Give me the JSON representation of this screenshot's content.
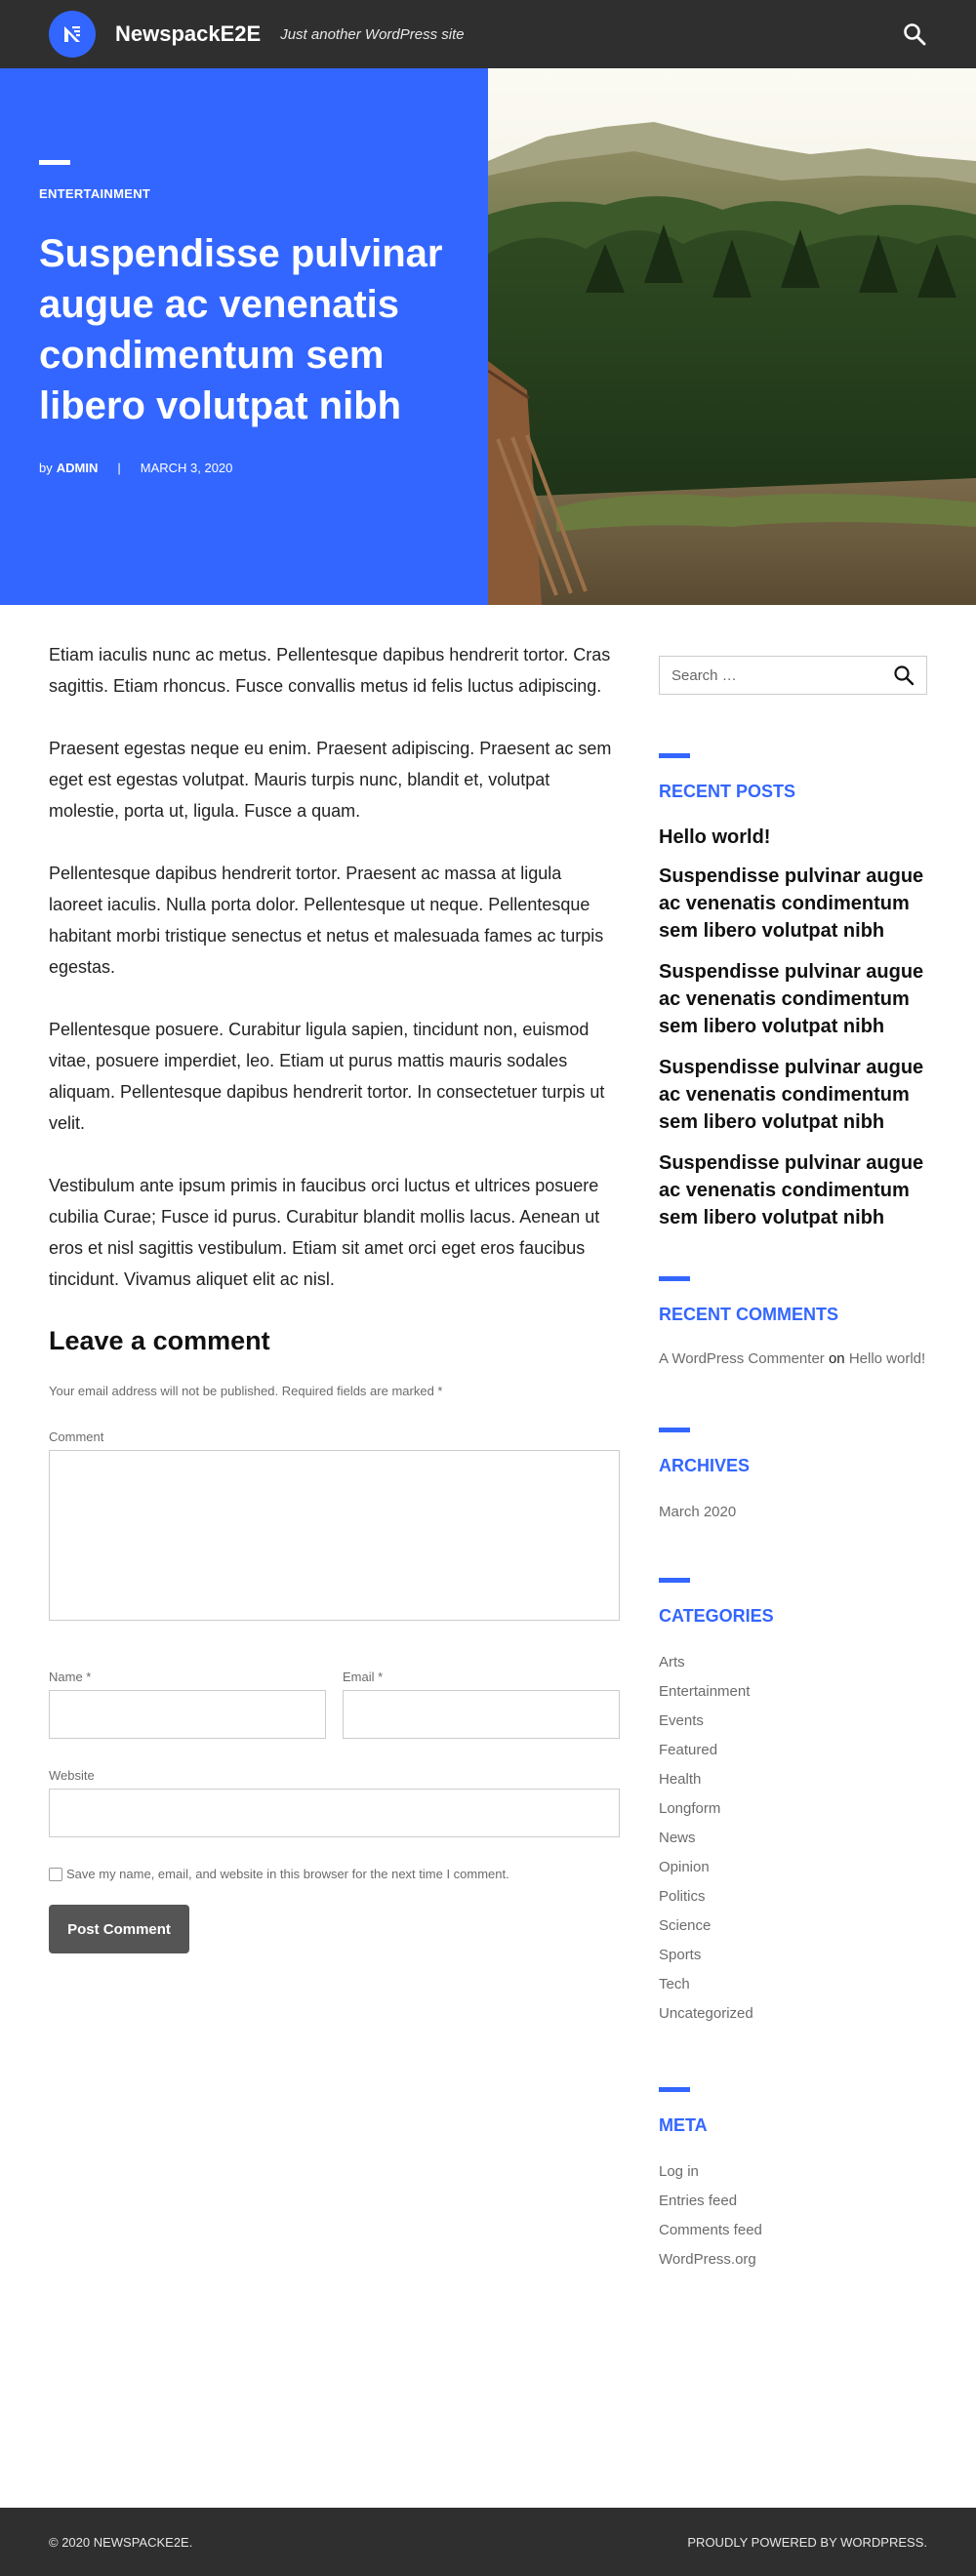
{
  "header": {
    "site_title": "NewspackE2E",
    "tagline": "Just another WordPress site"
  },
  "hero": {
    "category": "ENTERTAINMENT",
    "title": "Suspendisse pulvinar augue ac venenatis condimentum sem libero volutpat nibh",
    "by_label": "by",
    "author": "ADMIN",
    "separator": "|",
    "date": "MARCH 3, 2020"
  },
  "article": {
    "paragraphs": [
      "Etiam iaculis nunc ac metus. Pellentesque dapibus hendrerit tortor. Cras sagittis. Etiam rhoncus. Fusce convallis metus id felis luctus adipiscing.",
      "Praesent egestas neque eu enim. Praesent adipiscing. Praesent ac sem eget est egestas volutpat. Mauris turpis nunc, blandit et, volutpat molestie, porta ut, ligula. Fusce a quam.",
      "Pellentesque dapibus hendrerit tortor. Praesent ac massa at ligula laoreet iaculis. Nulla porta dolor. Pellentesque ut neque. Pellentesque habitant morbi tristique senectus et netus et malesuada fames ac turpis egestas.",
      "Pellentesque posuere. Curabitur ligula sapien, tincidunt non, euismod vitae, posuere imperdiet, leo. Etiam ut purus mattis mauris sodales aliquam. Pellentesque dapibus hendrerit tortor. In consectetuer turpis ut velit.",
      "Vestibulum ante ipsum primis in faucibus orci luctus et ultrices posuere cubilia Curae; Fusce id purus. Curabitur blandit mollis lacus. Aenean ut eros et nisl sagittis vestibulum. Etiam sit amet orci eget eros faucibus tincidunt. Vivamus aliquet elit ac nisl."
    ]
  },
  "comment_form": {
    "heading": "Leave a comment",
    "notes": "Your email address will not be published. Required fields are marked *",
    "comment_label": "Comment",
    "name_label": "Name *",
    "email_label": "Email *",
    "website_label": "Website",
    "cookie_label": "Save my name, email, and website in this browser for the next time I comment.",
    "submit_label": "Post Comment"
  },
  "sidebar": {
    "search_placeholder": "Search …",
    "recent_posts_title": "RECENT POSTS",
    "recent_posts": [
      "Hello world!",
      "Suspendisse pulvinar augue ac venenatis condimentum sem libero volutpat nibh",
      "Suspendisse pulvinar augue ac venenatis condimentum sem libero volutpat nibh",
      "Suspendisse pulvinar augue ac venenatis condimentum sem libero volutpat nibh",
      "Suspendisse pulvinar augue ac venenatis condimentum sem libero volutpat nibh"
    ],
    "recent_comments_title": "RECENT COMMENTS",
    "recent_comment": {
      "author": "A WordPress Commenter",
      "on": "on",
      "post": "Hello world!"
    },
    "archives_title": "ARCHIVES",
    "archives": [
      "March 2020"
    ],
    "categories_title": "CATEGORIES",
    "categories": [
      "Arts",
      "Entertainment",
      "Events",
      "Featured",
      "Health",
      "Longform",
      "News",
      "Opinion",
      "Politics",
      "Science",
      "Sports",
      "Tech",
      "Uncategorized"
    ],
    "meta_title": "META",
    "meta": [
      "Log in",
      "Entries feed",
      "Comments feed",
      "WordPress.org"
    ]
  },
  "footer": {
    "copyright": "© 2020 NEWSPACKE2E.",
    "powered": "PROUDLY POWERED BY WORDPRESS."
  },
  "colors": {
    "accent": "#3366ff",
    "header_bg": "#2f2f2f",
    "button_bg": "#555555"
  }
}
